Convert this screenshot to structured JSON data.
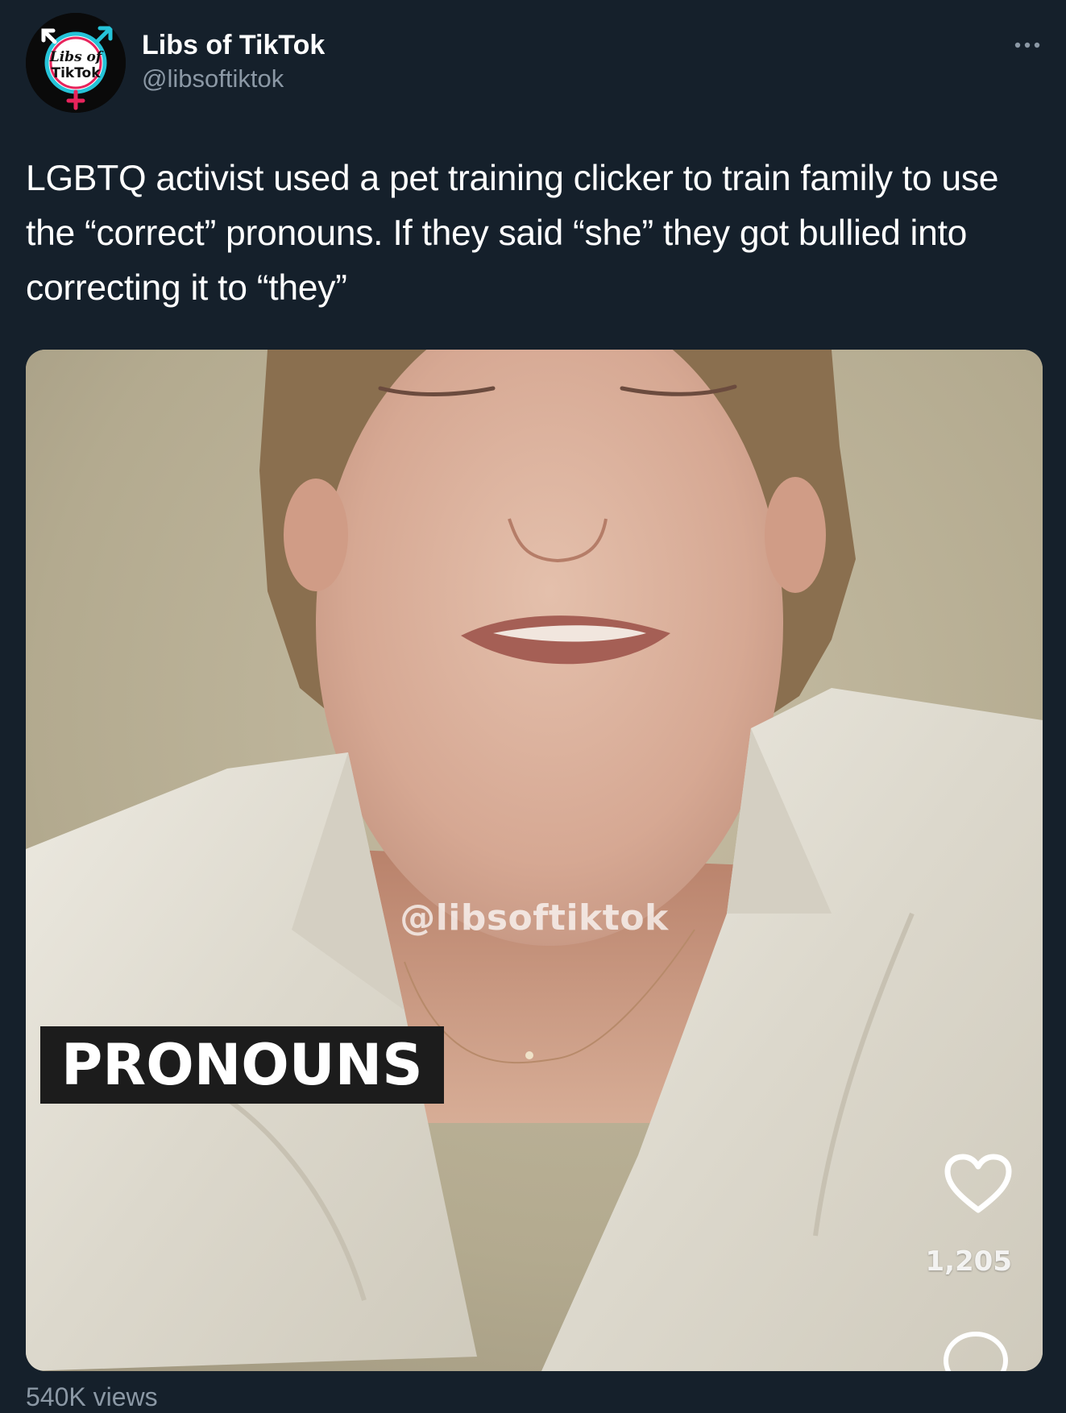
{
  "author": {
    "display_name": "Libs of TikTok",
    "handle": "@libsoftiktok",
    "avatar_text_line1": "Libs of",
    "avatar_text_line2": "TikTok"
  },
  "tweet": {
    "text": "LGBTQ activist used a pet training clicker to train family to use the “correct” pronouns. If they said “she” they got bullied into correcting it to “they”"
  },
  "media": {
    "watermark": "@libsoftiktok",
    "caption": "PRONOUNS",
    "like_count": "1,205"
  },
  "footer": {
    "views": "540K views"
  },
  "icons": {
    "more": "more-horizontal-icon",
    "like": "heart-icon",
    "comment": "comment-bubble-icon"
  },
  "colors": {
    "background": "#15202b",
    "secondary_text": "#8b98a5",
    "avatar_cyan": "#25c3d8",
    "avatar_pink": "#e8245c"
  }
}
